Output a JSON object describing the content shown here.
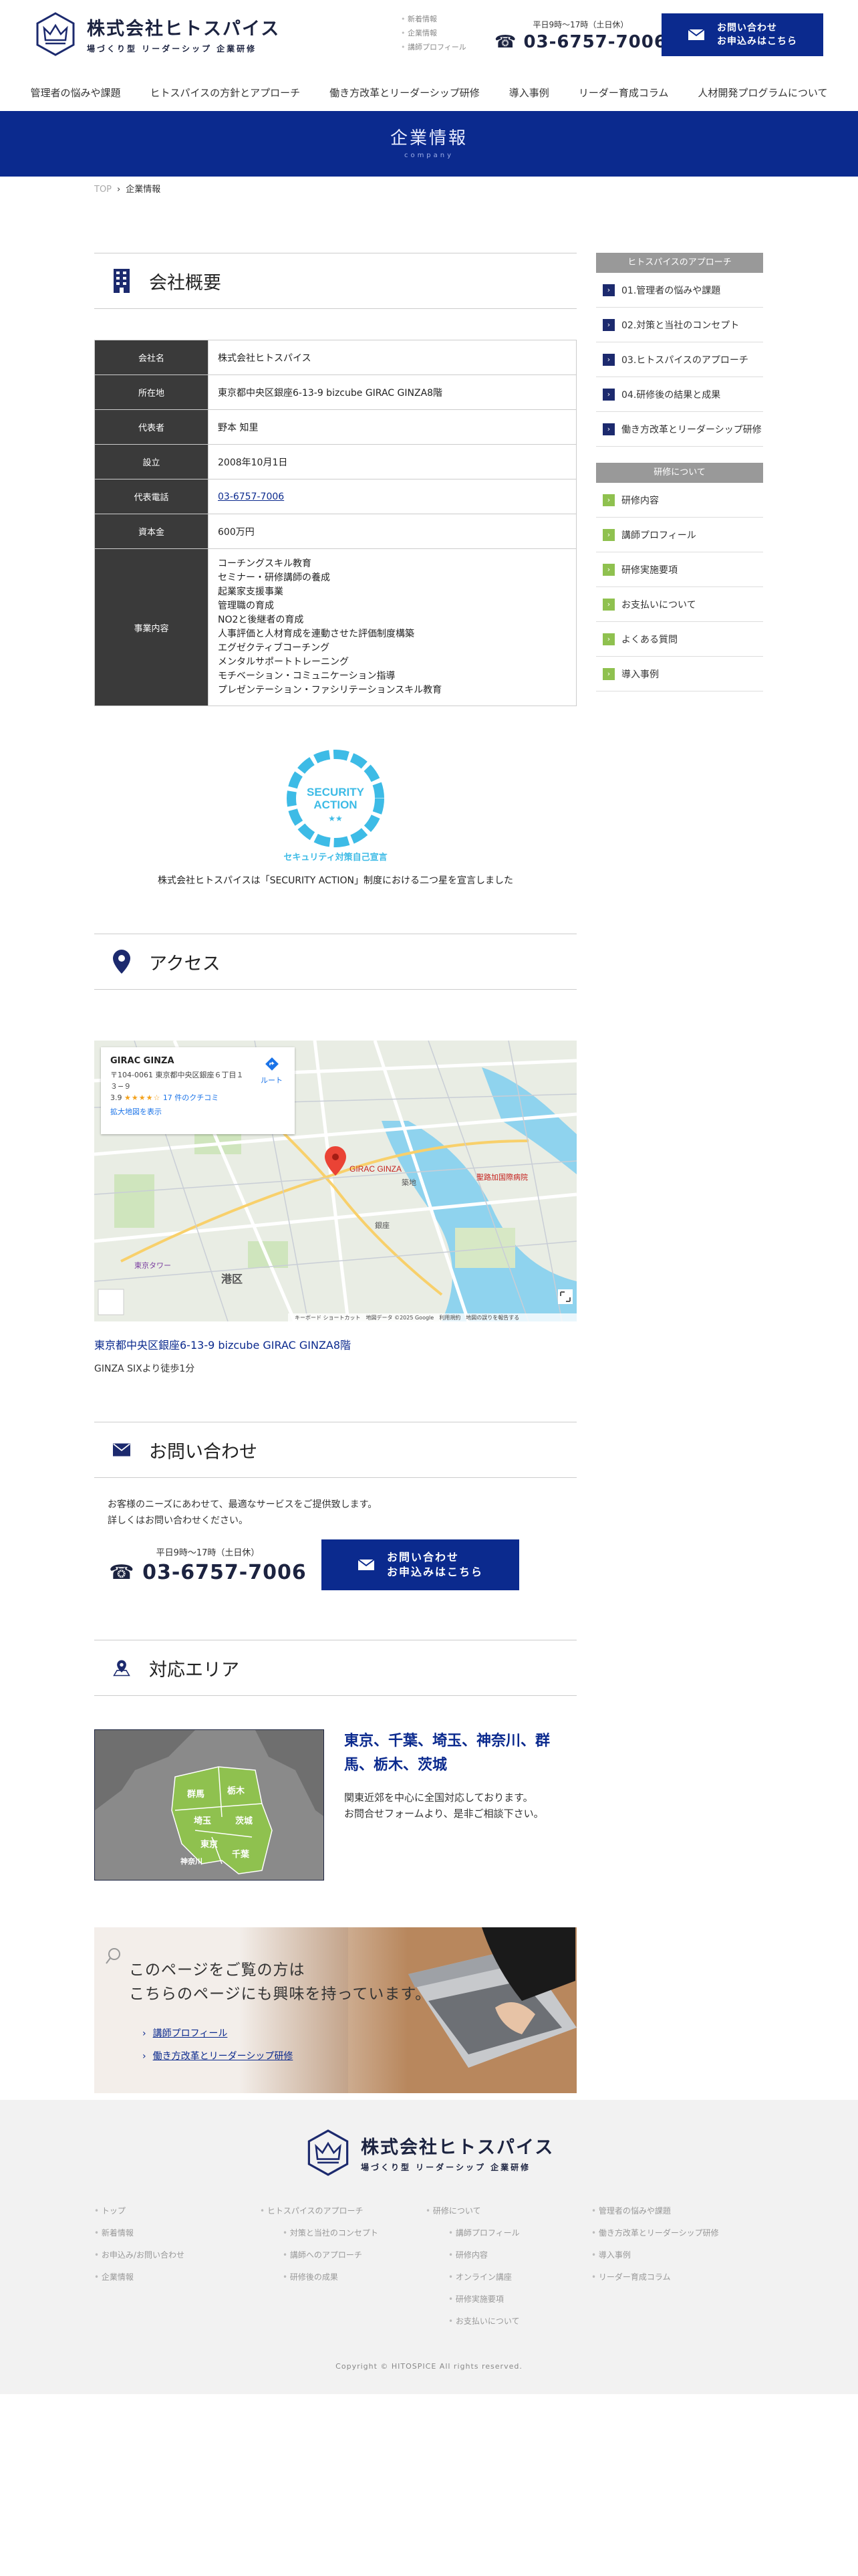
{
  "header": {
    "logo_name": "株式会社ヒトスパイス",
    "logo_tagline": "場づくり型 リーダーシップ 企業研修",
    "top_links": [
      "新着情報",
      "企業情報",
      "講師プロフィール"
    ],
    "hours": "平日9時〜17時（土日休）",
    "tel": "☎ 03-6757-7006",
    "cta_line1": "お問い合わせ",
    "cta_line2": "お申込みはこちら"
  },
  "nav": [
    "管理者の悩みや課題",
    "ヒトスパイスの方針とアプローチ",
    "働き方改革とリーダーシップ研修",
    "導入事例",
    "リーダー育成コラム",
    "人材開発プログラムについて"
  ],
  "banner": {
    "title": "企業情報",
    "subtitle": "company"
  },
  "breadcrumb": {
    "top": "TOP",
    "sep": "›",
    "current": "企業情報"
  },
  "overview": {
    "title": "会社概要",
    "rows": [
      {
        "label": "会社名",
        "value": "株式会社ヒトスパイス"
      },
      {
        "label": "所在地",
        "value": "東京都中央区銀座6-13-9 bizcube GIRAC GINZA8階"
      },
      {
        "label": "代表者",
        "value": "野本 知里"
      },
      {
        "label": "設立",
        "value": "2008年10月1日"
      },
      {
        "label": "代表電話",
        "value": "03-6757-7006"
      },
      {
        "label": "資本金",
        "value": "600万円"
      },
      {
        "label": "事業内容",
        "value": [
          "コーチングスキル教育",
          "セミナー・研修講師の養成",
          "起業家支援事業",
          "管理職の育成",
          "NO2と後継者の育成",
          "人事評価と人材育成を連動させた評価制度構築",
          "エグゼクティブコーチング",
          "メンタルサポートトレーニング",
          "モチベーション・コミュニケーション指導",
          "プレゼンテーション・ファシリテーションスキル教育"
        ]
      }
    ]
  },
  "security": {
    "badge_line1": "SECURITY",
    "badge_line2": "ACTION",
    "badge_stars": "★★",
    "badge_caption": "セキュリティ対策自己宣言",
    "statement": "株式会社ヒトスパイスは「SECURITY ACTION」制度における二つ星を宣言しました"
  },
  "access": {
    "title": "アクセス",
    "map": {
      "place": "GIRAC GINZA",
      "address": "〒104-0061 東京都中央区銀座６丁目１３−９",
      "rating": "3.9",
      "stars": "★★★★☆",
      "reviews": "17 件のクチコミ",
      "enlarge": "拡大地図を表示",
      "route": "ルート",
      "pin_label": "GIRAC GINZA",
      "labels": [
        "港区",
        "築地",
        "銀座",
        "東京タワー",
        "聖路加国際病院"
      ],
      "attribution": "キーボード ショートカット　地図データ ©2025 Google　利用規約　地図の誤りを報告する"
    },
    "address": "東京都中央区銀座6-13-9 bizcube GIRAC GINZA8階",
    "walk": "GINZA SIXより徒歩1分"
  },
  "contact": {
    "title": "お問い合わせ",
    "text_line1": "お客様のニーズにあわせて、最適なサービスをご提供致します。",
    "text_line2": "詳しくはお問い合わせください。",
    "hours": "平日9時〜17時（土日休）",
    "tel": "☎ 03-6757-7006",
    "cta_line1": "お問い合わせ",
    "cta_line2": "お申込みはこちら"
  },
  "area": {
    "title": "対応エリア",
    "heading": "東京、千葉、埼玉、神奈川、群馬、栃木、茨城",
    "text_line1": "関東近郊を中心に全国対応しております。",
    "text_line2": "お問合せフォームより、是非ご相談下さい。",
    "prefectures": [
      "群馬",
      "栃木",
      "埼玉",
      "茨城",
      "東京",
      "神奈川",
      "千葉"
    ]
  },
  "related": {
    "title_line1": "このページをご覧の方は",
    "title_line2": "こちらのページにも興味を持っています。",
    "links": [
      "講師プロフィール",
      "働き方改革とリーダーシップ研修"
    ]
  },
  "sidebar": {
    "group1": {
      "title": "ヒトスパイスのアプローチ",
      "items": [
        "01.管理者の悩みや課題",
        "02.対策と当社のコンセプト",
        "03.ヒトスパイスのアプローチ",
        "04.研修後の結果と成果",
        "働き方改革とリーダーシップ研修"
      ]
    },
    "group2": {
      "title": "研修について",
      "items": [
        "研修内容",
        "講師プロフィール",
        "研修実施要項",
        "お支払いについて",
        "よくある質問",
        "導入事例"
      ]
    }
  },
  "footer": {
    "logo_name": "株式会社ヒトスパイス",
    "logo_tagline": "場づくり型 リーダーシップ 企業研修",
    "col1": [
      "トップ",
      "新着情報",
      "お申込み/お問い合わせ",
      "企業情報"
    ],
    "col2_main": "ヒトスパイスのアプローチ",
    "col2_sub": [
      "対策と当社のコンセプト",
      "講師へのアプローチ",
      "研修後の成果"
    ],
    "col3_main": "研修について",
    "col3_sub": [
      "講師プロフィール",
      "研修内容",
      "オンライン講座",
      "研修実施要項",
      "お支払いについて"
    ],
    "col4": [
      "管理者の悩みや課題",
      "働き方改革とリーダーシップ研修",
      "導入事例",
      "リーダー育成コラム"
    ],
    "copyright": "Copyright © HITOSPICE All rights reserved."
  },
  "colors": {
    "primary": "#0b2a8e",
    "dark": "#1c2340",
    "th_bg": "#3a3a3a",
    "accent_green": "#8fc14f",
    "badge_blue": "#3dbbe6"
  }
}
